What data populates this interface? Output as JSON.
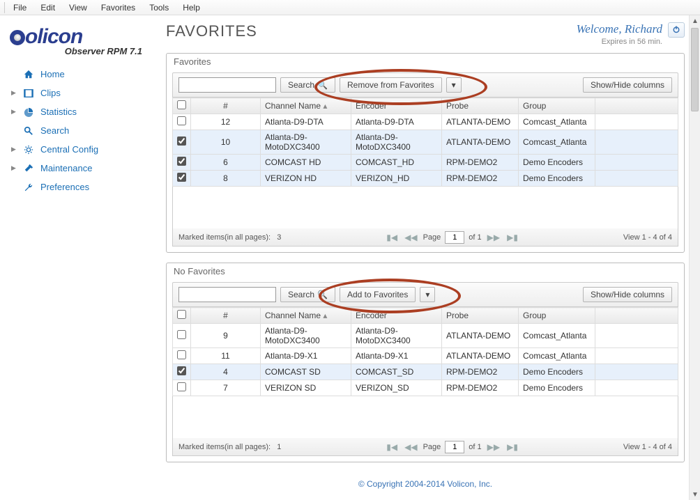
{
  "menubar": [
    "File",
    "Edit",
    "View",
    "Favorites",
    "Tools",
    "Help"
  ],
  "brand": {
    "name": "Volicon",
    "sub": "Observer RPM 7.1"
  },
  "nav": [
    {
      "label": "Home",
      "icon": "home"
    },
    {
      "label": "Clips",
      "icon": "clips",
      "expandable": true
    },
    {
      "label": "Statistics",
      "icon": "stats",
      "expandable": true
    },
    {
      "label": "Search",
      "icon": "search"
    },
    {
      "label": "Central Config",
      "icon": "config",
      "expandable": true
    },
    {
      "label": "Maintenance",
      "icon": "maint",
      "expandable": true
    },
    {
      "label": "Preferences",
      "icon": "prefs"
    }
  ],
  "header": {
    "title": "FAVORITES",
    "welcome_prefix": "Welcome, ",
    "welcome_name": "Richard",
    "expires": "Expires in 56 min."
  },
  "panel_favorites": {
    "title": "Favorites",
    "search_btn": "Search",
    "action_btn": "Remove from Favorites",
    "showhide_btn": "Show/Hide columns",
    "columns": [
      "#",
      "Channel Name",
      "Encoder",
      "Probe",
      "Group"
    ],
    "rows": [
      {
        "checked": false,
        "num": "12",
        "channel": "Atlanta-D9-DTA",
        "encoder": "Atlanta-D9-DTA",
        "probe": "ATLANTA-DEMO",
        "group": "Comcast_Atlanta"
      },
      {
        "checked": true,
        "num": "10",
        "channel": "Atlanta-D9-MotoDXC3400",
        "encoder": "Atlanta-D9-MotoDXC3400",
        "probe": "ATLANTA-DEMO",
        "group": "Comcast_Atlanta"
      },
      {
        "checked": true,
        "num": "6",
        "channel": "COMCAST HD",
        "encoder": "COMCAST_HD",
        "probe": "RPM-DEMO2",
        "group": "Demo Encoders"
      },
      {
        "checked": true,
        "num": "8",
        "channel": "VERIZON HD",
        "encoder": "VERIZON_HD",
        "probe": "RPM-DEMO2",
        "group": "Demo Encoders"
      }
    ],
    "marked_label": "Marked items(in all pages):",
    "marked_count": "3",
    "page_word": "Page",
    "page_cur": "1",
    "page_of": "of 1",
    "view_text": "View 1 - 4 of 4"
  },
  "panel_nofav": {
    "title": "No Favorites",
    "search_btn": "Search",
    "action_btn": "Add to Favorites",
    "showhide_btn": "Show/Hide columns",
    "columns": [
      "#",
      "Channel Name",
      "Encoder",
      "Probe",
      "Group"
    ],
    "rows": [
      {
        "checked": false,
        "num": "9",
        "channel": "Atlanta-D9-MotoDXC3400",
        "encoder": "Atlanta-D9-MotoDXC3400",
        "probe": "ATLANTA-DEMO",
        "group": "Comcast_Atlanta"
      },
      {
        "checked": false,
        "num": "11",
        "channel": "Atlanta-D9-X1",
        "encoder": "Atlanta-D9-X1",
        "probe": "ATLANTA-DEMO",
        "group": "Comcast_Atlanta"
      },
      {
        "checked": true,
        "num": "4",
        "channel": "COMCAST SD",
        "encoder": "COMCAST_SD",
        "probe": "RPM-DEMO2",
        "group": "Demo Encoders"
      },
      {
        "checked": false,
        "num": "7",
        "channel": "VERIZON SD",
        "encoder": "VERIZON_SD",
        "probe": "RPM-DEMO2",
        "group": "Demo Encoders"
      }
    ],
    "marked_label": "Marked items(in all pages):",
    "marked_count": "1",
    "page_word": "Page",
    "page_cur": "1",
    "page_of": "of 1",
    "view_text": "View 1 - 4 of 4"
  },
  "footer": "© Copyright 2004-2014 Volicon, Inc."
}
